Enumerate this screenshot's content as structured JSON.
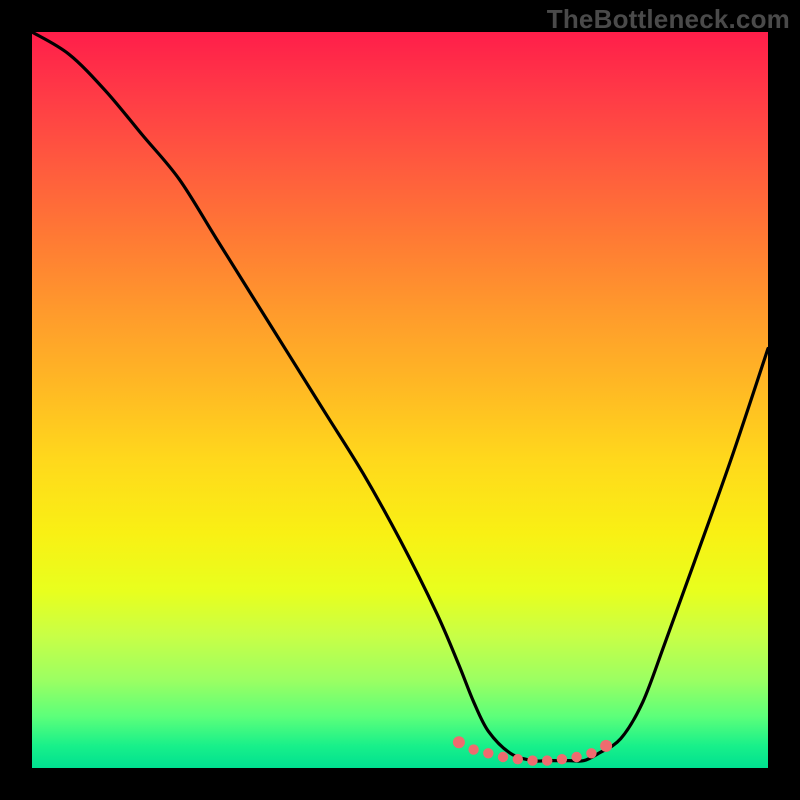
{
  "watermark": "TheBottleneck.com",
  "colors": {
    "background": "#000000",
    "curve_stroke": "#000000",
    "marker_fill": "#ef6b6f",
    "marker_stroke": "#ef6b6f"
  },
  "chart_data": {
    "type": "line",
    "title": "",
    "xlabel": "",
    "ylabel": "",
    "xlim": [
      0,
      100
    ],
    "ylim": [
      0,
      100
    ],
    "series": [
      {
        "name": "bottleneck-curve",
        "x": [
          0,
          5,
          10,
          15,
          20,
          25,
          30,
          35,
          40,
          45,
          50,
          55,
          58,
          60,
          62,
          65,
          68,
          70,
          73,
          75,
          77,
          80,
          83,
          86,
          90,
          95,
          100
        ],
        "values": [
          100,
          97,
          92,
          86,
          80,
          72,
          64,
          56,
          48,
          40,
          31,
          21,
          14,
          9,
          5,
          2,
          1,
          1,
          1,
          1,
          2,
          4,
          9,
          17,
          28,
          42,
          57
        ]
      }
    ],
    "markers": {
      "name": "bottleneck-minimum-band",
      "x": [
        58,
        60,
        62,
        64,
        66,
        68,
        70,
        72,
        74,
        76,
        78
      ],
      "values": [
        3.5,
        2.5,
        2.0,
        1.5,
        1.2,
        1.0,
        1.0,
        1.2,
        1.5,
        2.0,
        3.0
      ]
    }
  }
}
